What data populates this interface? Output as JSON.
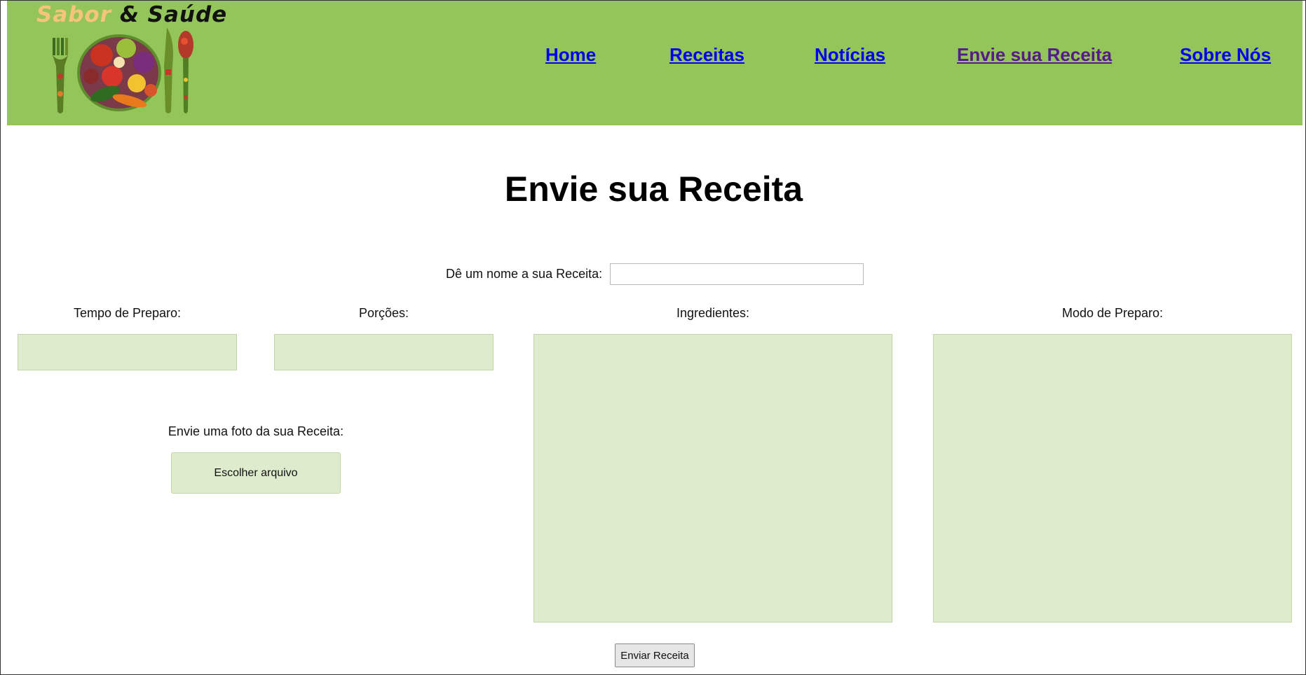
{
  "header": {
    "logo": {
      "word1": "Sabor",
      "word2": "&",
      "word3": "Saúde",
      "colors": {
        "word1": "#f6c47a",
        "rest": "#111111",
        "background": "#94c55a"
      }
    },
    "nav": [
      {
        "label": "Home"
      },
      {
        "label": "Receitas"
      },
      {
        "label": "Notícias"
      },
      {
        "label": "Envie sua Receita"
      },
      {
        "label": "Sobre Nós"
      }
    ]
  },
  "main": {
    "title": "Envie sua Receita",
    "recipe_name": {
      "label": "Dê um nome a sua Receita:",
      "value": ""
    },
    "prep_time": {
      "label": "Tempo de Preparo:",
      "value": ""
    },
    "servings": {
      "label": "Porções:",
      "value": ""
    },
    "ingredients": {
      "label": "Ingredientes:",
      "value": ""
    },
    "method": {
      "label": "Modo de Preparo:",
      "value": ""
    },
    "photo": {
      "label": "Envie uma foto da sua Receita:",
      "button": "Escolher arquivo"
    },
    "submit": "Enviar Receita"
  }
}
